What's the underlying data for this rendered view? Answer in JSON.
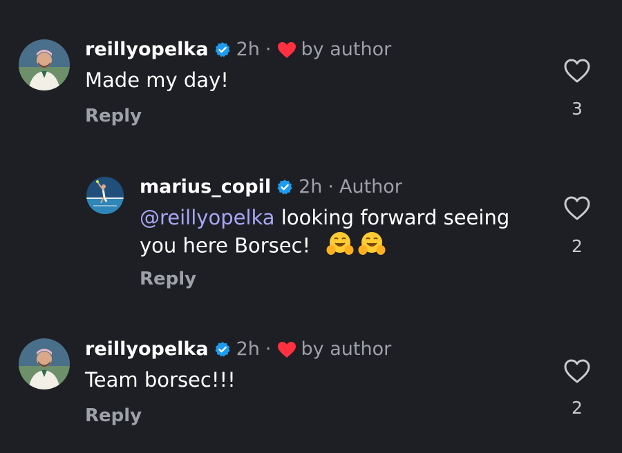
{
  "comments": [
    {
      "username": "reillyopelka",
      "time": "2h",
      "by_author": "by author",
      "text": "Made my day!",
      "reply_label": "Reply",
      "likes": "3"
    },
    {
      "username": "marius_copil",
      "time": "2h",
      "author_tag": "Author",
      "mention": "@reillyopelka",
      "text_line1": " looking forward seeing",
      "text_line2": "you here Borsec!",
      "emojis": [
        "hugging-face-emoji",
        "hugging-face-emoji"
      ],
      "reply_label": "Reply",
      "likes": "2"
    },
    {
      "username": "reillyopelka",
      "time": "2h",
      "by_author": "by author",
      "text": "Team borsec!!!",
      "reply_label": "Reply",
      "likes": "2"
    }
  ],
  "separator": "·",
  "colors": {
    "background": "#1e1f24",
    "verified": "#1d9bf0",
    "liked_heart": "#ff3040",
    "mention": "#a8a6f8",
    "muted": "#9ea1a8"
  },
  "icons": {
    "verified": "verified-badge-icon",
    "author_heart": "heart-filled-icon",
    "like": "heart-outline-icon"
  }
}
